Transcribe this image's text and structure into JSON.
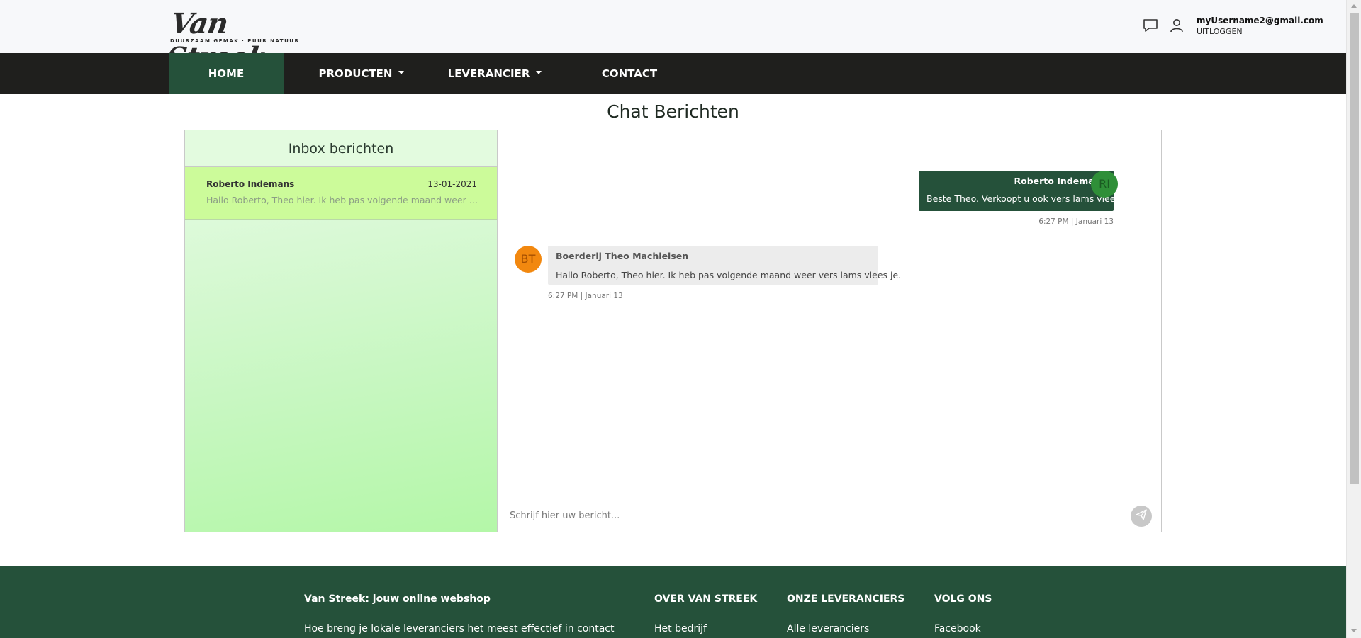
{
  "brand": {
    "logo_text": "Van Streek",
    "logo_tagline": "DUURZAAM GEMAK · PUUR NATUUR"
  },
  "header": {
    "user_email": "myUsername2@gmail.com",
    "logout_label": "UITLOGGEN",
    "icons": [
      "chat-bubble-icon",
      "user-icon"
    ]
  },
  "nav": {
    "items": [
      {
        "label": "HOME",
        "active": true
      },
      {
        "label": "PRODUCTEN",
        "dropdown": true
      },
      {
        "label": "LEVERANCIER",
        "dropdown": true
      },
      {
        "label": "CONTACT"
      }
    ]
  },
  "page": {
    "title": "Chat Berichten"
  },
  "inbox": {
    "heading": "Inbox berichten",
    "items": [
      {
        "name": "Roberto Indemans",
        "date": "13-01-2021",
        "preview": "Hallo Roberto, Theo hier. Ik heb pas volgende maand weer vers lams vlees je."
      }
    ]
  },
  "conversation": {
    "messages": [
      {
        "direction": "outgoing",
        "avatar_initials": "RI",
        "sender": "Roberto Indemans",
        "text": "Beste Theo. Verkoopt u ook vers lams vlees?",
        "time": "6:27 PM | Januari 13"
      },
      {
        "direction": "incoming",
        "avatar_initials": "BT",
        "sender": "Boerderij Theo Machielsen",
        "text": "Hallo Roberto, Theo hier. Ik heb pas volgende maand weer vers lams vlees je.",
        "time": "6:27 PM | Januari 13"
      }
    ]
  },
  "composer": {
    "placeholder": "Schrijf hier uw bericht...",
    "value": "",
    "send_icon": "paper-plane-icon"
  },
  "footer": {
    "columns": [
      {
        "heading": "Van Streek: jouw online webshop",
        "link": "Hoe breng je lokale leveranciers het meest effectief in contact"
      },
      {
        "heading": "OVER VAN STREEK",
        "link": "Het bedrijf"
      },
      {
        "heading": "ONZE LEVERANCIERS",
        "link": "Alle leveranciers"
      },
      {
        "heading": "VOLG ONS",
        "link": "Facebook"
      }
    ]
  },
  "colors": {
    "brand_green": "#25513a",
    "nav_dark": "#1f1f1d",
    "inbox_item_bg": "#ccfb9a",
    "avatar_ri": "#2f8f38",
    "avatar_bt": "#f2880f"
  }
}
